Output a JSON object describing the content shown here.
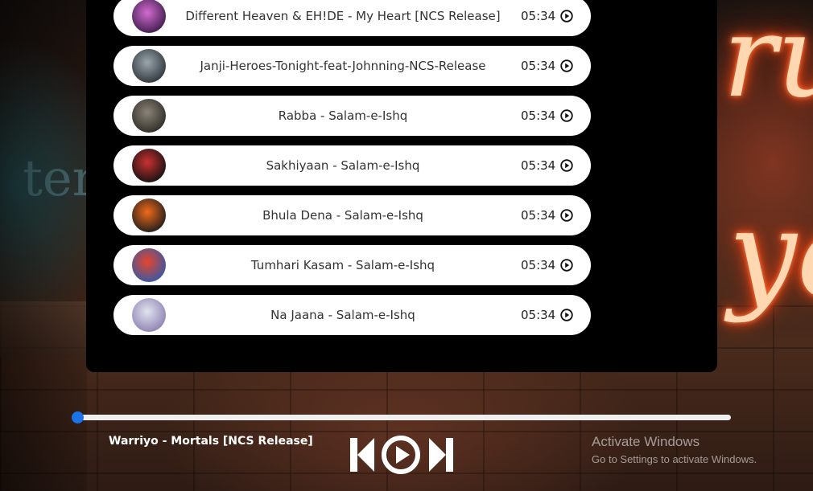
{
  "colors": {
    "accent": "#1a73e8",
    "panel": "#000000",
    "row": "#ffffff"
  },
  "playlist": [
    {
      "title": "Different Heaven & EH!DE - My Heart [NCS Release]",
      "duration": "05:34",
      "icon": "play-circle-icon",
      "thumb_colors": [
        "#d26bd0",
        "#3b1a4a"
      ]
    },
    {
      "title": "Janji-Heroes-Tonight-feat-Johnning-NCS-Release",
      "duration": "05:34",
      "icon": "play-circle-icon",
      "thumb_colors": [
        "#9aa6ad",
        "#2c3338"
      ]
    },
    {
      "title": "Rabba - Salam-e-Ishq",
      "duration": "05:34",
      "icon": "play-circle-icon",
      "thumb_colors": [
        "#8a8378",
        "#2d2a25"
      ]
    },
    {
      "title": "Sakhiyaan - Salam-e-Ishq",
      "duration": "05:34",
      "icon": "play-circle-icon",
      "thumb_colors": [
        "#c93030",
        "#111111"
      ]
    },
    {
      "title": "Bhula Dena - Salam-e-Ishq",
      "duration": "05:34",
      "icon": "play-circle-icon",
      "thumb_colors": [
        "#f06a1a",
        "#1b1b1b"
      ]
    },
    {
      "title": "Tumhari Kasam - Salam-e-Ishq",
      "duration": "05:34",
      "icon": "play-circle-icon",
      "thumb_colors": [
        "#e8442c",
        "#2f5aa8"
      ]
    },
    {
      "title": "Na Jaana - Salam-e-Ishq",
      "duration": "05:34",
      "icon": "play-circle-icon",
      "thumb_colors": [
        "#dfe4ee",
        "#8d7fb0"
      ]
    }
  ],
  "player": {
    "now_playing": "Warriyo - Mortals [NCS Release]",
    "progress": 0.0,
    "controls": {
      "previous_icon": "skip-previous-icon",
      "play_icon": "play-circle-icon",
      "next_icon": "skip-next-icon"
    }
  },
  "watermark": {
    "line1": "Activate Windows",
    "line2": "Go to Settings to activate Windows."
  }
}
